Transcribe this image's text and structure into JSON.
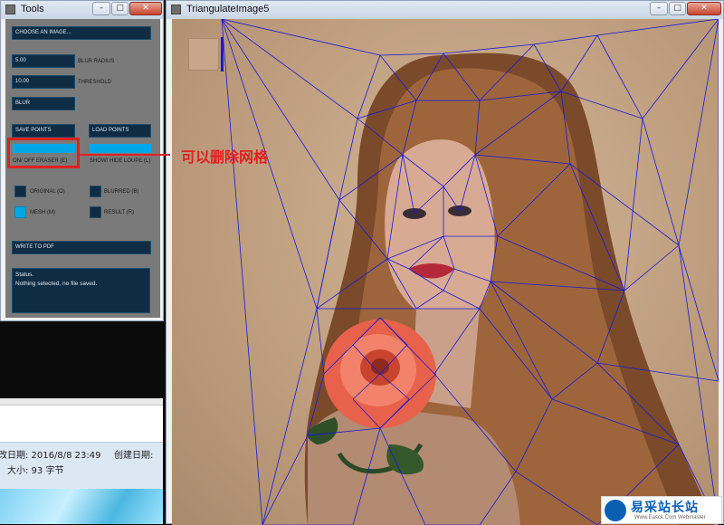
{
  "tools_window": {
    "title": "Tools",
    "choose_image": "CHOOSE AN IMAGE...",
    "blur_radius_value": "5.00",
    "blur_radius_label": "BLUR RADIUS",
    "threshold_value": "10.00",
    "threshold_label": "THRESHOLD",
    "blur_button": "BLUR",
    "save_points": "SAVE POINTS",
    "load_points": "LOAD POINTS",
    "eraser_label": "ON/ OFF ERASER (E)",
    "loupe_label": "SHOW/ HIDE LOUPE (L)",
    "original_label": "ORIGINAL (O)",
    "blurred_label": "BLURRED (B)",
    "mesh_label": "MESH (M)",
    "result_label": "RESULT (R)",
    "write_pdf": "WRITE TO PDF",
    "status_title": "Status.",
    "status_text": "Nothing selected, no file saved.",
    "toggles": {
      "original": false,
      "blurred": false,
      "mesh": true,
      "result": false
    }
  },
  "image_window": {
    "title": "TriangulateImage5"
  },
  "annotation": {
    "text": "可以删除网格",
    "color": "#e02020"
  },
  "explorer": {
    "modified": "改日期: 2016/8/8 23:49",
    "created": "创建日期:",
    "size": "大小: 93 字节"
  },
  "watermark": {
    "title": "易采站长站",
    "subtitle": "Www.Easck.Com Webmaster"
  },
  "colors": {
    "panel_bg": "#7a7a7a",
    "field_bg": "#0e2c44",
    "accent": "#00a7e6",
    "mesh_line": "#1a1ad6",
    "photo_bg": "#c3a282"
  }
}
